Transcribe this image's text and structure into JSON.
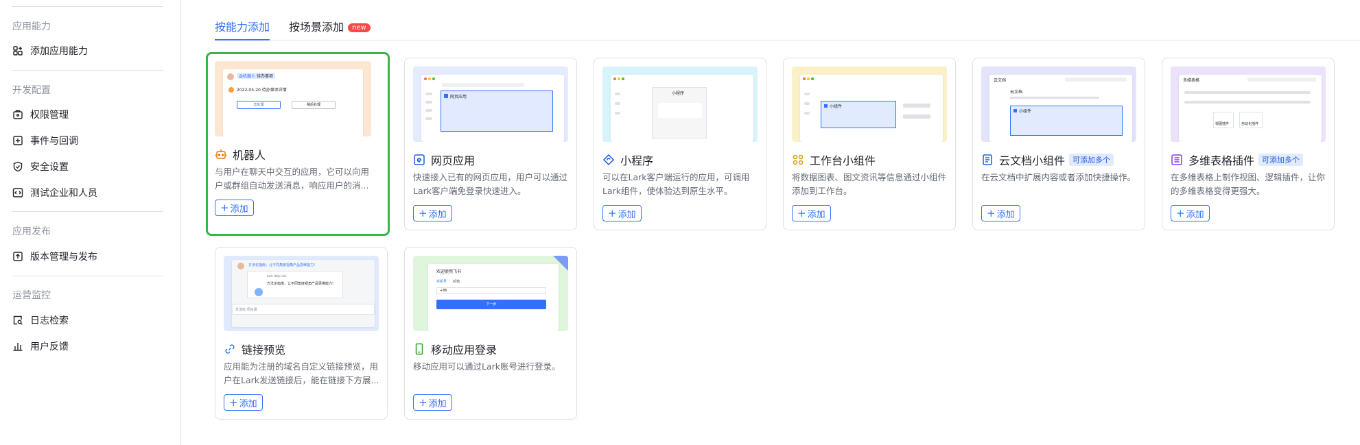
{
  "sidebar": {
    "sections": [
      {
        "title": "应用能力",
        "items": [
          {
            "label": "添加应用能力",
            "icon": "add-capability-icon"
          }
        ]
      },
      {
        "title": "开发配置",
        "items": [
          {
            "label": "权限管理",
            "icon": "permission-icon"
          },
          {
            "label": "事件与回调",
            "icon": "event-icon"
          },
          {
            "label": "安全设置",
            "icon": "shield-icon"
          },
          {
            "label": "测试企业和人员",
            "icon": "code-icon"
          }
        ]
      },
      {
        "title": "应用发布",
        "items": [
          {
            "label": "版本管理与发布",
            "icon": "upload-icon"
          }
        ]
      },
      {
        "title": "运营监控",
        "items": [
          {
            "label": "日志检索",
            "icon": "log-search-icon"
          },
          {
            "label": "用户反馈",
            "icon": "chart-icon"
          }
        ]
      }
    ]
  },
  "tabs": [
    {
      "label": "按能力添加",
      "active": true
    },
    {
      "label": "按场景添加",
      "badge": "new"
    }
  ],
  "cards": [
    {
      "title": "机器人",
      "desc": "与用户在聊天中交互的应用，它可以向用户或群组自动发送消息，响应用户的消...",
      "add": "添加",
      "icon": "robot-icon",
      "thumb": {
        "tag": "@机器人",
        "tag2": "待办事项",
        "line": "2022-05-20 待办事项详情",
        "btn1": "去处理",
        "btn2": "稍后处理"
      }
    },
    {
      "title": "网页应用",
      "desc": "快速接入已有的网页应用，用户可以通过Lark客户端免登录快速进入。",
      "add": "添加",
      "icon": "web-app-icon",
      "thumb": {
        "label": "网页应用"
      }
    },
    {
      "title": "小程序",
      "desc": "可以在Lark客户端运行的应用，可调用Lark组件，使体验达到原生水平。",
      "add": "添加",
      "icon": "mini-program-icon",
      "thumb": {
        "label": "小程序"
      }
    },
    {
      "title": "工作台小组件",
      "desc": "将数据图表、图文资讯等信息通过小组件添加到工作台。",
      "add": "添加",
      "icon": "widget-icon",
      "thumb": {
        "label": "小组件"
      }
    },
    {
      "title": "云文档小组件",
      "badge": "可添加多个",
      "desc": "在云文档中扩展内容或者添加快捷操作。",
      "add": "添加",
      "icon": "doc-icon",
      "thumb": {
        "label": "云文档",
        "sub": "云文档",
        "box": "小组件"
      }
    },
    {
      "title": "多维表格插件",
      "badge": "可添加多个",
      "desc": "在多维表格上制作视图、逻辑插件，让你的多维表格变得更强大。",
      "add": "添加",
      "icon": "table-icon",
      "thumb": {
        "label": "多维表格",
        "a": "视图插件",
        "b": "自动化插件"
      }
    },
    {
      "title": "链接预览",
      "desc": "应用能为注册的域名自定义链接预览，用户在Lark发送链接后，能在链接下方展...",
      "add": "添加",
      "icon": "link-icon",
      "thumb": {
        "line1": "方法论指南，让不同角度视角产品思维能力!",
        "line2": "Lark Help Link",
        "line3": "方法论指南，让不同角度视角产品思维能力!",
        "input": "发送给 项目组"
      }
    },
    {
      "title": "移动应用登录",
      "desc": "移动应用可以通过Lark账号进行登录。",
      "add": "添加",
      "icon": "mobile-icon",
      "thumb": {
        "welcome": "欢迎使用飞书",
        "tab1": "手机号",
        "tab2": "邮箱",
        "code": "+86",
        "btn": "下一步"
      }
    }
  ]
}
